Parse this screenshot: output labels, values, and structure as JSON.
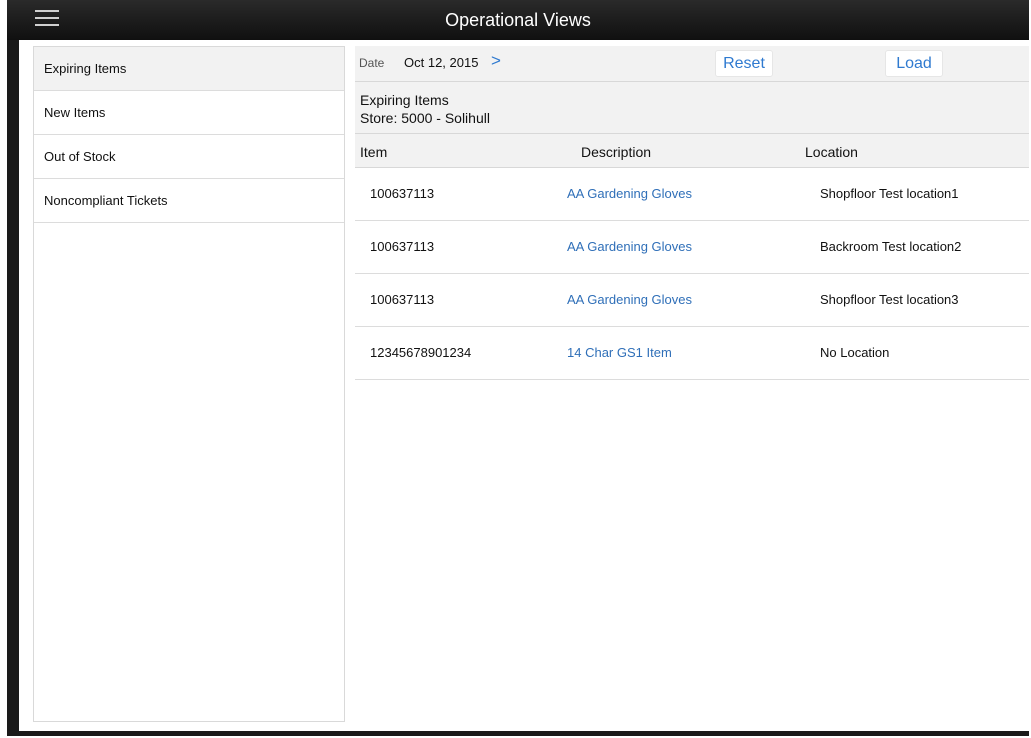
{
  "app": {
    "title": "Operational Views"
  },
  "sidebar": {
    "items": [
      {
        "label": "Expiring Items"
      },
      {
        "label": "New Items"
      },
      {
        "label": "Out of Stock"
      },
      {
        "label": "Noncompliant Tickets"
      }
    ]
  },
  "datebar": {
    "date_label": "Date",
    "date_value": "Oct 12, 2015",
    "chevron": ">",
    "reset_label": "Reset",
    "load_label": "Load"
  },
  "section": {
    "title": "Expiring Items",
    "store": "Store: 5000 - Solihull"
  },
  "table": {
    "columns": [
      "Item",
      "Description",
      "Location"
    ],
    "rows": [
      {
        "item": "100637113",
        "description": "AA Gardening Gloves",
        "location": "Shopfloor Test location1"
      },
      {
        "item": "100637113",
        "description": "AA Gardening Gloves",
        "location": "Backroom Test location2"
      },
      {
        "item": "100637113",
        "description": "AA Gardening Gloves",
        "location": "Shopfloor Test location3"
      },
      {
        "item": "12345678901234",
        "description": "14 Char GS1 Item",
        "location": "No Location"
      }
    ]
  },
  "colors": {
    "accent": "#2f7ad0",
    "titlebar": "#1a1a1a"
  }
}
